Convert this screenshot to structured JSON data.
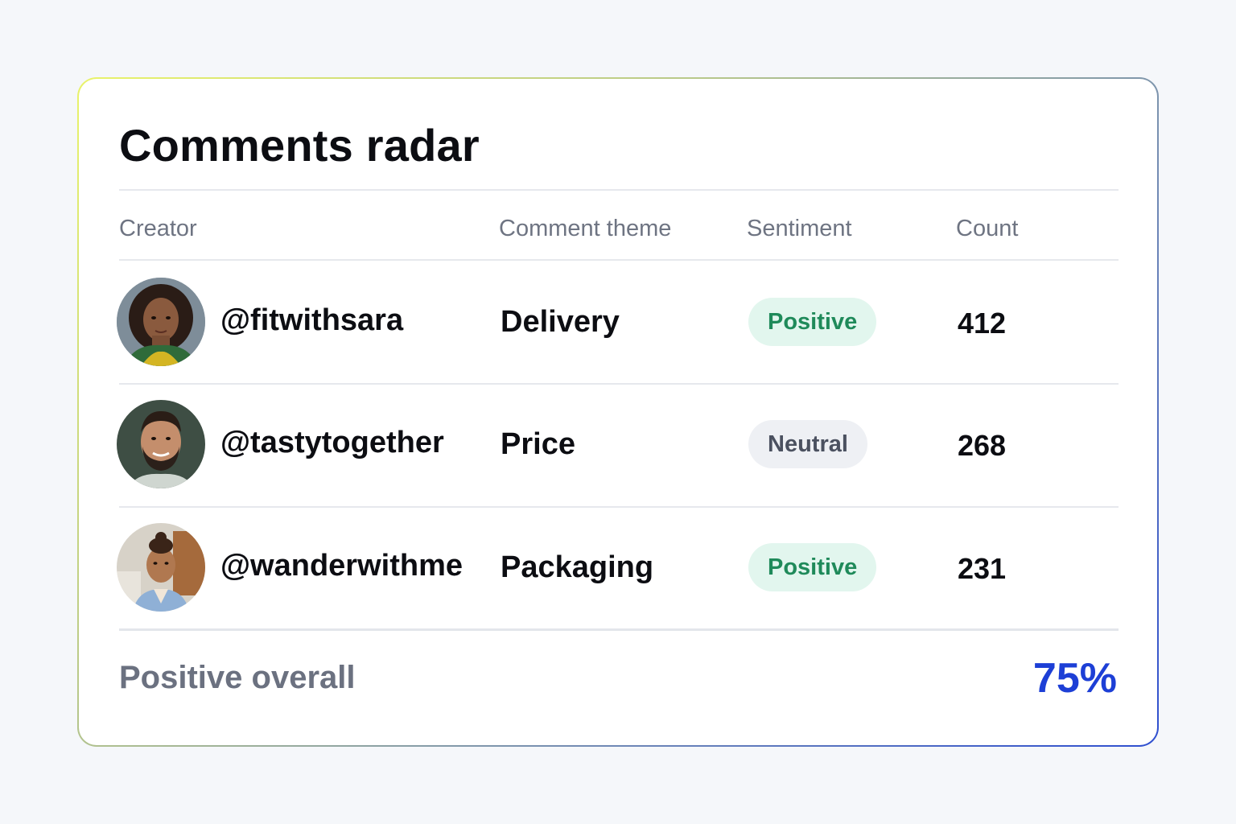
{
  "widget": {
    "title": "Comments radar",
    "columns": {
      "creator": "Creator",
      "theme": "Comment theme",
      "sentiment": "Sentiment",
      "count": "Count"
    },
    "rows": [
      {
        "creator": "@fitwithsara",
        "theme": "Delivery",
        "sentiment": "Positive",
        "count": "412"
      },
      {
        "creator": "@tastytogether",
        "theme": "Price",
        "sentiment": "Neutral",
        "count": "268"
      },
      {
        "creator": "@wanderwithme",
        "theme": "Packaging",
        "sentiment": "Positive",
        "count": "231"
      }
    ],
    "footer": {
      "label": "Positive overall",
      "value": "75%"
    }
  },
  "colors": {
    "accent": "#1d3fd6",
    "positive_bg": "#e2f6ee",
    "positive_text": "#1f8a5a",
    "neutral_bg": "#eef0f4",
    "neutral_text": "#4b5160"
  }
}
